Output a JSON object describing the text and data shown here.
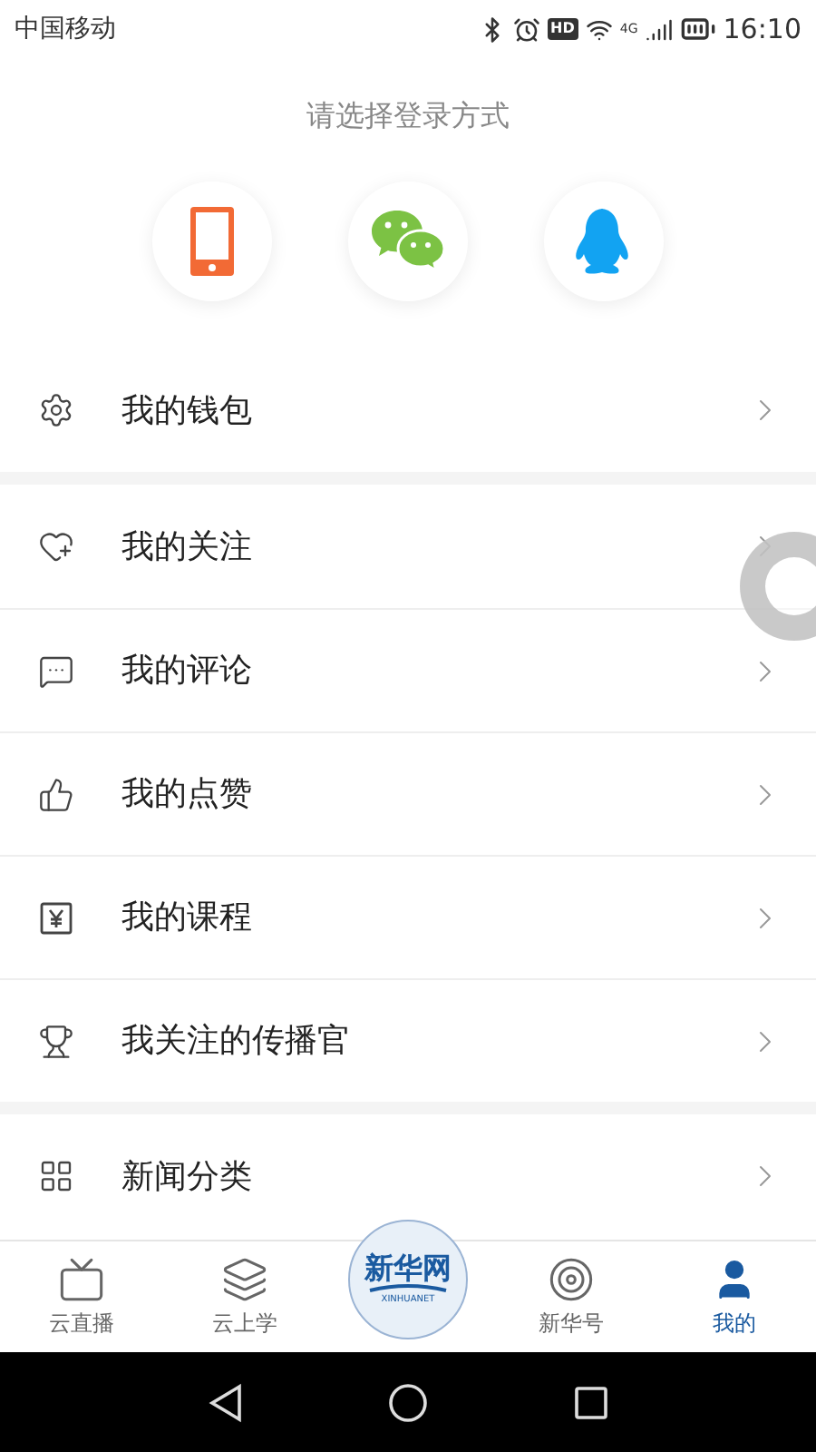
{
  "status_bar": {
    "carrier": "中国移动",
    "hd": "HD",
    "network": "4G",
    "time": "16:10"
  },
  "login": {
    "prompt": "请选择登录方式",
    "methods": [
      {
        "kind": "phone"
      },
      {
        "kind": "wechat"
      },
      {
        "kind": "qq"
      }
    ]
  },
  "sections": [
    {
      "items": [
        {
          "kind": "wallet",
          "label": "我的钱包"
        }
      ]
    },
    {
      "items": [
        {
          "kind": "follow",
          "label": "我的关注"
        },
        {
          "kind": "comment",
          "label": "我的评论"
        },
        {
          "kind": "like",
          "label": "我的点赞"
        },
        {
          "kind": "course",
          "label": "我的课程"
        },
        {
          "kind": "trophy",
          "label": "我关注的传播官"
        }
      ]
    },
    {
      "items": [
        {
          "kind": "grid",
          "label": "新闻分类"
        }
      ]
    }
  ],
  "tabs": [
    {
      "kind": "live",
      "label": "云直播",
      "selected": false
    },
    {
      "kind": "learn",
      "label": "云上学",
      "selected": false
    },
    {
      "kind": "logo",
      "title": "新华网",
      "subtitle": "XINHUANET",
      "selected": false
    },
    {
      "kind": "target",
      "label": "新华号",
      "selected": false
    },
    {
      "kind": "me",
      "label": "我的",
      "selected": true
    }
  ]
}
